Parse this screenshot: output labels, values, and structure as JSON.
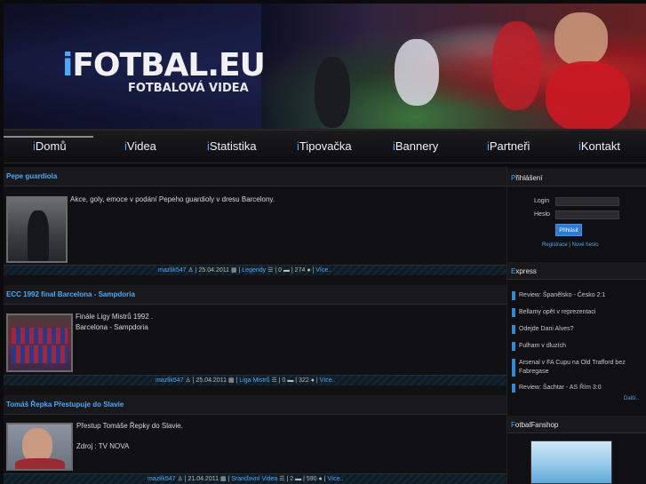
{
  "header": {
    "logo_i": "i",
    "logo_text": "FOTBAL.EU",
    "logo_subtitle": "FOTBALOVÁ VIDEA"
  },
  "nav": {
    "prefix": "i",
    "items": [
      "Domů",
      "Videa",
      "Statistika",
      "Tipovačka",
      "Bannery",
      "Partneři",
      "Kontakt"
    ],
    "active_index": 0
  },
  "posts": [
    {
      "title": "Pepe guardiola",
      "text_lines": [
        "Akce, goly, emoce v podání Pepeho guardioly v dresu Barcelony."
      ],
      "author": "mazlik547",
      "date": "25.04.2011",
      "category": "Legendy",
      "comments": "0",
      "views": "274",
      "more": "Více.."
    },
    {
      "title": "ECC 1992 final Barcelona - Sampdoria",
      "text_lines": [
        "Finále Ligy Mistrů 1992 .",
        "Barcelona - Sampdoria"
      ],
      "author": "mazlik547",
      "date": "25.04.2011",
      "category": "Liga Mistrů",
      "comments": "0",
      "views": "322",
      "more": "Více.."
    },
    {
      "title": "Tomáš Řepka Přestupuje do Slavie",
      "text_lines": [
        "Přestup Tomáše Řepky do Slavie.",
        "",
        "Zdroj : TV NOVA"
      ],
      "author": "mazlik547",
      "date": "21.04.2011",
      "category": "Sranďovní Videa",
      "comments": "2",
      "views": "590",
      "more": "Více.."
    }
  ],
  "login": {
    "title_first": "P",
    "title_rest": "řihlášení",
    "login_label": "Login",
    "password_label": "Heslo",
    "submit_label": "Přihlásit",
    "register_link": "Registrace",
    "separator": "|",
    "new_password_link": "Nové heslo"
  },
  "express": {
    "title_first": "E",
    "title_rest": "xpress",
    "items": [
      "Review: Španělsko - Česko 2:1",
      "Bellamy opět v reprezentaci",
      "Odejde Dani Alves?",
      "Fulham v dluzích",
      "Arsenal v FA Cupu na Old Trafford bez Fabregase",
      "Review: Šachtar - AS Řím 3:0"
    ],
    "more": "Další.."
  },
  "fanshop": {
    "title_first": "F",
    "title_rest": "otbalFanshop"
  },
  "colors": {
    "accent": "#4aa8ff",
    "background": "#0b0b0c",
    "button": "#2a7dd6"
  }
}
